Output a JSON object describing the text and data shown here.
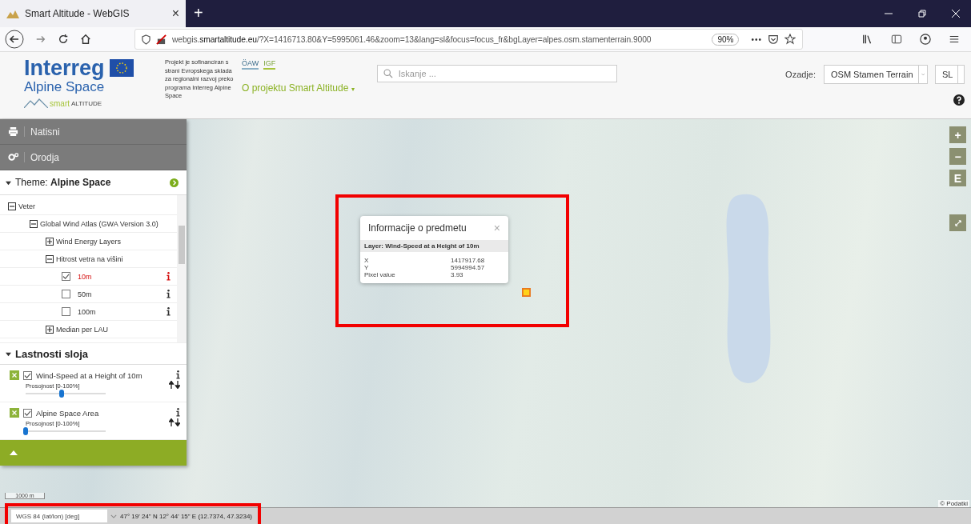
{
  "browser": {
    "tab": {
      "title": "Smart Altitude - WebGIS",
      "close": "×"
    },
    "new_tab": "+",
    "url": {
      "prefix": "webgis.",
      "domain": "smartaltitude.eu",
      "path": "/?X=1416713.80&Y=5995061.46&zoom=13&lang=sl&focus=focus_fr&bgLayer=alpes.osm.stamenterrain.9000"
    },
    "zoom": "90%",
    "more": "•••"
  },
  "header": {
    "logo_title": "Interreg",
    "logo_subtitle": "Alpine Space",
    "project_prefix": "smart",
    "project_name": "ALTITUDE",
    "funding_text": "Projekt je sofinanciran s strani Evropskega sklada za regionalni razvoj preko programa Interreg Alpine Space",
    "partner_logos": [
      "ÖAW",
      "IGF"
    ],
    "about_link": "O projektu Smart Altitude",
    "about_caret": "▾",
    "search": {
      "placeholder": "Iskanje ..."
    },
    "background_label": "Ozadje:",
    "background_value": "OSM Stamen Terrain",
    "language_value": "SL"
  },
  "sidebar": {
    "menu": [
      {
        "label": "Natisni"
      },
      {
        "label": "Orodja"
      }
    ],
    "theme": {
      "label": "Theme:",
      "value": "Alpine Space",
      "expanded": true
    },
    "tree": [
      {
        "kind": "group",
        "label": "Veter",
        "expanded": true,
        "children": [
          {
            "kind": "group",
            "label": "Global Wind Atlas (GWA Version 3.0)",
            "expanded": true,
            "children": [
              {
                "kind": "group",
                "label": "Wind Energy Layers",
                "expanded": false
              },
              {
                "kind": "group",
                "label": "Hitrost vetra na višini",
                "expanded": true,
                "children": [
                  {
                    "kind": "layer",
                    "label": "10m",
                    "checked": true
                  },
                  {
                    "kind": "layer",
                    "label": "50m",
                    "checked": false
                  },
                  {
                    "kind": "layer",
                    "label": "100m",
                    "checked": false
                  }
                ]
              },
              {
                "kind": "group",
                "label": "Median per LAU",
                "expanded": false
              }
            ]
          }
        ]
      }
    ],
    "properties": {
      "title": "Lastnosti sloja",
      "expanded": true,
      "layers": [
        {
          "name": "Wind-Speed at a Height of 10m",
          "checked": true,
          "opacity_label": "Prosojnost [0-100%]",
          "level": 0.45
        },
        {
          "name": "Alpine Space Area",
          "checked": true,
          "opacity_label": "Prosojnost [0-100%]",
          "level": 0.0
        }
      ]
    },
    "collapsed": false
  },
  "map": {
    "controls": [
      "+",
      "−",
      "E"
    ],
    "scale": "1000 m",
    "attribution": "© Podatki",
    "popup": {
      "title": "Informacije o predmetu",
      "close": "×",
      "layer": "Layer: Wind-Speed at a Height of 10m",
      "rows": [
        {
          "key": "X",
          "value": "1417917.68"
        },
        {
          "key": "Y",
          "value": "5994994.57"
        },
        {
          "key": "Pixel value",
          "value": "3.93"
        }
      ]
    }
  },
  "status_bar": {
    "projection": "WGS 84 (lat/lon) [deg]",
    "coordinates": "47° 19' 24\" N 12° 44' 15\" E (12.7374, 47.3234)"
  }
}
